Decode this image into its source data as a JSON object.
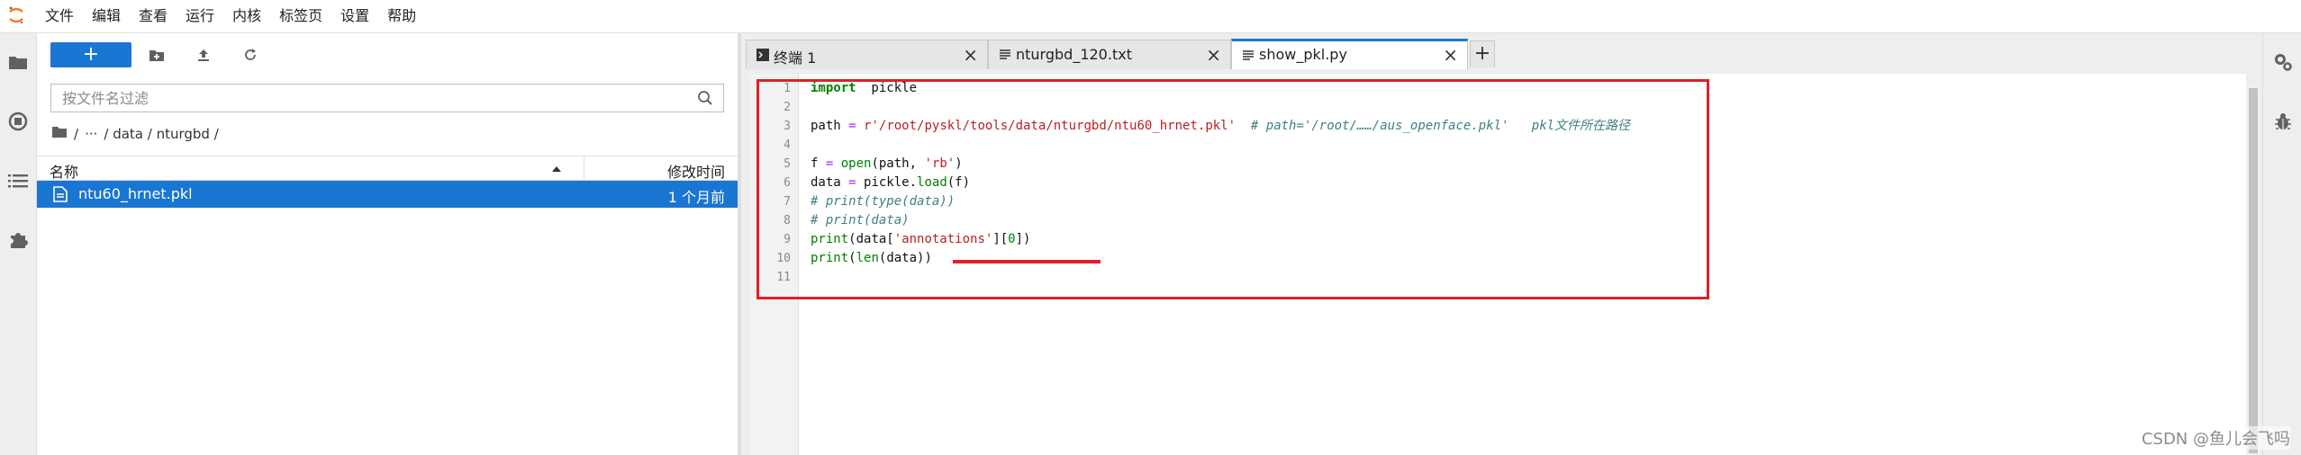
{
  "menubar": {
    "items": [
      "文件",
      "编辑",
      "查看",
      "运行",
      "内核",
      "标签页",
      "设置",
      "帮助"
    ]
  },
  "file_browser": {
    "new_button_label": "+",
    "filter_placeholder": "按文件名过滤",
    "breadcrumb": [
      "/",
      "···",
      "/ data / nturgbd /"
    ],
    "columns": {
      "name": "名称",
      "modified": "修改时间"
    },
    "files": [
      {
        "name": "ntu60_hrnet.pkl",
        "modified": "1 个月前",
        "selected": true
      }
    ]
  },
  "tabs": [
    {
      "label": "终端 1",
      "icon": "terminal-icon",
      "active": false
    },
    {
      "label": "nturgbd_120.txt",
      "icon": "text-file-icon",
      "active": false
    },
    {
      "label": "show_pkl.py",
      "icon": "text-file-icon",
      "active": true
    }
  ],
  "tab_close_symbol": "×",
  "tab_add_symbol": "+",
  "editor": {
    "line_numbers": [
      "1",
      "2",
      "3",
      "4",
      "5",
      "6",
      "7",
      "8",
      "9",
      "10",
      "11"
    ],
    "annotation_color": "#e0202a"
  },
  "watermark": "CSDN @鱼儿会飞吗",
  "colors": {
    "accent": "#1976d2",
    "annotation": "#e0202a"
  }
}
